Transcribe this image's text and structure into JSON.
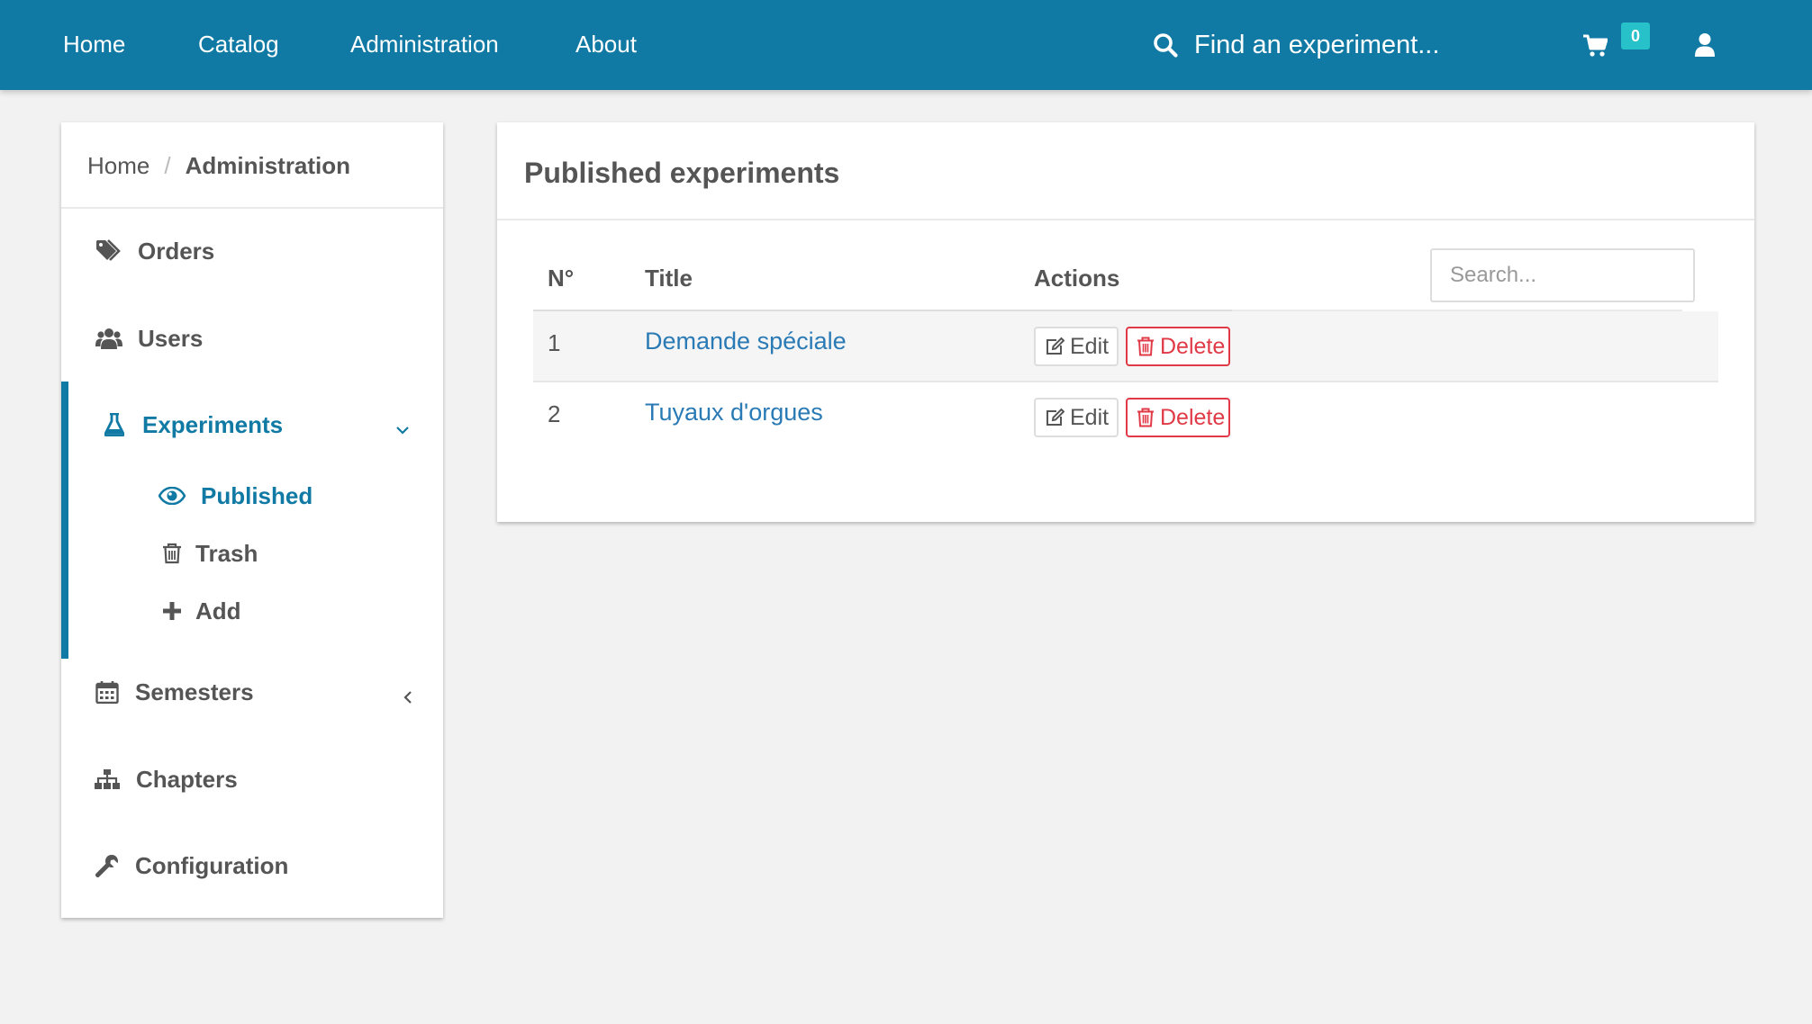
{
  "navbar": {
    "links": [
      "Home",
      "Catalog",
      "Administration",
      "About"
    ],
    "search_placeholder": "Find an experiment...",
    "cart_count": "0",
    "colors": {
      "background": "#117aa4",
      "badge": "#26c1c9"
    }
  },
  "sidebar": {
    "breadcrumb": {
      "home": "Home",
      "separator": "/",
      "current": "Administration"
    },
    "items": [
      {
        "label": "Orders",
        "icon": "tags-icon"
      },
      {
        "label": "Users",
        "icon": "users-icon"
      },
      {
        "label": "Experiments",
        "icon": "flask-icon",
        "active": true,
        "expanded": true
      },
      {
        "label": "Semesters",
        "icon": "calendar-icon",
        "collapsed": true
      },
      {
        "label": "Chapters",
        "icon": "sitemap-icon"
      },
      {
        "label": "Configuration",
        "icon": "wrench-icon"
      }
    ],
    "experiments_subitems": [
      {
        "label": "Published",
        "icon": "eye-icon",
        "active": true
      },
      {
        "label": "Trash",
        "icon": "trash-icon"
      },
      {
        "label": "Add",
        "icon": "plus-icon"
      }
    ],
    "active_color": "#117aa4"
  },
  "main": {
    "title": "Published experiments",
    "search_placeholder": "Search...",
    "columns": [
      "N°",
      "Title",
      "Actions"
    ],
    "rows": [
      {
        "number": "1",
        "title": "Demande spéciale"
      },
      {
        "number": "2",
        "title": "Tuyaux d'orgues"
      }
    ],
    "actions": {
      "edit_label": "Edit",
      "delete_label": "Delete"
    },
    "colors": {
      "link": "#2a7ab5",
      "danger": "#e03a46"
    }
  }
}
